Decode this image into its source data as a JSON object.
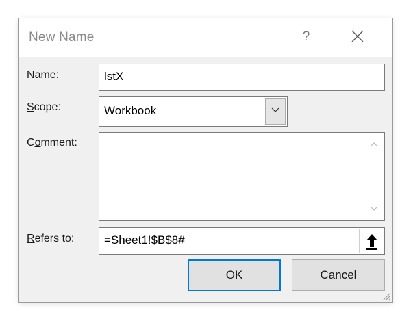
{
  "dialog": {
    "title": "New Name",
    "help_glyph": "?",
    "close_icon": "close-icon"
  },
  "fields": {
    "name": {
      "label_accel": "N",
      "label_rest": "ame:",
      "value": "lstX"
    },
    "scope": {
      "label_accel": "S",
      "label_rest": "cope:",
      "value": "Workbook"
    },
    "comment": {
      "label_pre": "C",
      "label_accel": "o",
      "label_rest": "mment:",
      "value": ""
    },
    "refers_to": {
      "label_accel": "R",
      "label_rest": "efers to:",
      "value": "=Sheet1!$B$8#"
    }
  },
  "buttons": {
    "ok": "OK",
    "cancel": "Cancel"
  },
  "colors": {
    "default_button_border": "#0078d7",
    "dialog_bg": "#f0f0f0",
    "title_text": "#8a8a8a"
  }
}
